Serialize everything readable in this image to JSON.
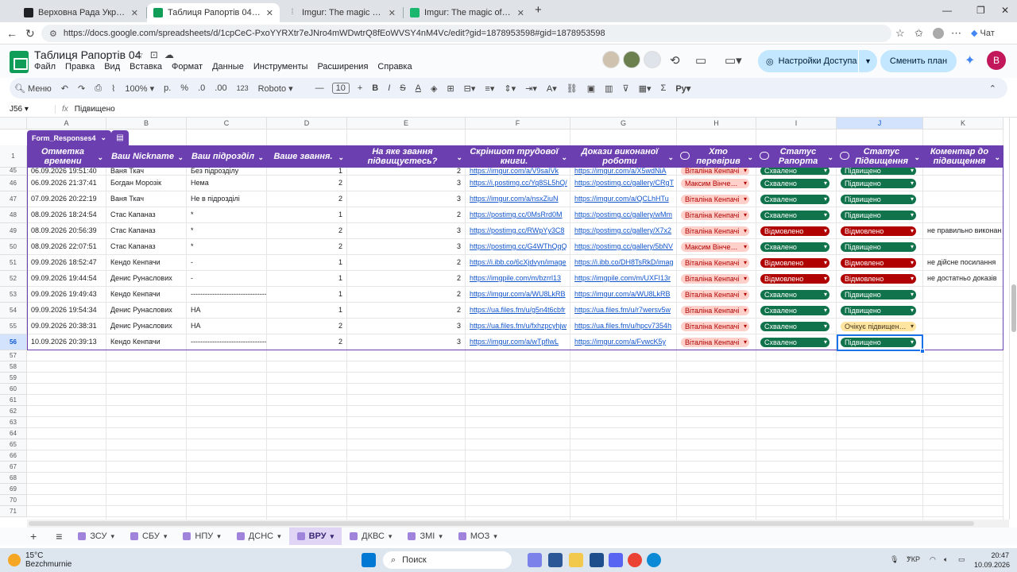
{
  "browser": {
    "tabs": [
      {
        "title": "Верховна Рада України | Рапорт",
        "color": "#202124"
      },
      {
        "title": "Таблиця Рапортів 04 - Google Та",
        "color": "#0f9d58"
      },
      {
        "title": "Imgur: The magic of the Internet",
        "color": "#777777"
      },
      {
        "title": "Imgur: The magic of the Internet",
        "color": "#1bb76e"
      }
    ],
    "url": "https://docs.google.com/spreadsheets/d/1cpCeC-PxoYYRXtr7eJNro4mWDwtrQ8fEoWVSY4nM4Vc/edit?gid=1878953598#gid=1878953598",
    "chat_label": "Чат"
  },
  "app": {
    "title": "Таблиця Рапортів 04",
    "menu": [
      "Файл",
      "Правка",
      "Вид",
      "Вставка",
      "Формат",
      "Данные",
      "Инструменты",
      "Расширения",
      "Справка"
    ],
    "share_label": "Настройки Доступа",
    "plan_label": "Сменить план",
    "user_initial": "B"
  },
  "toolbar": {
    "menu_label": "Меню",
    "zoom": "100%",
    "currency": "р.",
    "percent": "%",
    "dec_less": ".0",
    "dec_more": ".00",
    "num_format": "123",
    "font": "Roboto",
    "font_size": "10"
  },
  "formula_bar": {
    "cell": "J56",
    "value": "Підвищено"
  },
  "columns": [
    "A",
    "B",
    "C",
    "D",
    "E",
    "F",
    "G",
    "H",
    "I",
    "J",
    "K"
  ],
  "table": {
    "name": "Form_Responses4",
    "headers": [
      "Отметка времени",
      "Ваш Nickname",
      "Ваш підрозділ",
      "Ваше звання.",
      "На яке звання підвищуєтесь?",
      "Скріншот трудової книги.",
      "Докази виконаної роботи",
      "Хто перевірив",
      "Статус Рапорта",
      "Статус Підвищення",
      "Коментар до підвищення"
    ],
    "rows": [
      {
        "n": "45",
        "a": "06.09.2026 19:51:40",
        "b": "Ваня Ткач",
        "c": "Без підрозділу",
        "d": "1",
        "e": "2",
        "f": "https://imgur.com/a/V9saIVk",
        "g": "https://imgur.com/a/X5wdNiA",
        "h": "Віталіна Кенпачі",
        "i": "Схвалено",
        "j": "Підвищено",
        "k": ""
      },
      {
        "n": "46",
        "a": "06.09.2026 21:37:41",
        "b": "Богдан Морозік",
        "c": "Нема",
        "d": "2",
        "e": "3",
        "f": "https://i.postimg.cc/Yq8SL5hQ/",
        "g": "https://postimg.cc/gallery/CRgT",
        "h": "Максим Вінчестер",
        "i": "Схвалено",
        "j": "Підвищено",
        "k": ""
      },
      {
        "n": "47",
        "a": "07.09.2026 20:22:19",
        "b": "Ваня Ткач",
        "c": "Не в підрозділі",
        "d": "2",
        "e": "3",
        "f": "https://imgur.com/a/nsxZiuN",
        "g": "https://imgur.com/a/QCLhHTu",
        "h": "Віталіна Кенпачі",
        "i": "Схвалено",
        "j": "Підвищено",
        "k": ""
      },
      {
        "n": "48",
        "a": "08.09.2026 18:24:54",
        "b": "Стас Капаназ",
        "c": "*",
        "d": "1",
        "e": "2",
        "f": "https://postimg.cc/0MsRrd0M",
        "g": "https://postimg.cc/gallery/wMm",
        "h": "Віталіна Кенпачі",
        "i": "Схвалено",
        "j": "Підвищено",
        "k": ""
      },
      {
        "n": "49",
        "a": "08.09.2026 20:56:39",
        "b": "Стас Капаназ",
        "c": "*",
        "d": "2",
        "e": "3",
        "f": "https://postimg.cc/RWpYy3C8",
        "g": "https://postimg.cc/gallery/X7x2",
        "h": "Віталіна Кенпачі",
        "i": "Відмовлено",
        "j": "Відмовлено",
        "k": "не правильно виконан"
      },
      {
        "n": "50",
        "a": "08.09.2026 22:07:51",
        "b": "Стас Капаназ",
        "c": "*",
        "d": "2",
        "e": "3",
        "f": "https://postimg.cc/G4WThQqQ",
        "g": "https://postimg.cc/gallery/5bNV",
        "h": "Максим Вінчестер",
        "i": "Схвалено",
        "j": "Підвищено",
        "k": ""
      },
      {
        "n": "51",
        "a": "09.09.2026 18:52:47",
        "b": "Кендо Кенпачи",
        "c": "-",
        "d": "1",
        "e": "2",
        "f": "https://i.ibb.co/6cXjdvyn/image",
        "g": "https://i.ibb.co/DH8TsRkD/imag",
        "h": "Віталіна Кенпачі",
        "i": "Відмовлено",
        "j": "Відмовлено",
        "k": "не дійсне посилання"
      },
      {
        "n": "52",
        "a": "09.09.2026 19:44:54",
        "b": "Денис Рунасловиx",
        "c": "-",
        "d": "1",
        "e": "2",
        "f": "https://imgpile.com/m/bzrrl13",
        "g": "https://imgpile.com/m/UXFI13r",
        "h": "Віталіна Кенпачі",
        "i": "Відмовлено",
        "j": "Відмовлено",
        "k": "не достатньо доказів"
      },
      {
        "n": "53",
        "a": "09.09.2026 19:49:43",
        "b": "Кендо Кенпачи",
        "c": "-------------------------------------",
        "d": "1",
        "e": "2",
        "f": "https://imgur.com/a/WU8LkRB",
        "g": "https://imgur.com/a/WU8LkRB",
        "h": "Віталіна Кенпачі",
        "i": "Схвалено",
        "j": "Підвищено",
        "k": ""
      },
      {
        "n": "54",
        "a": "09.09.2026 19:54:34",
        "b": "Денис Рунасловиx",
        "c": "НА",
        "d": "1",
        "e": "2",
        "f": "https://ua.files.fm/u/g5n4t6cbfr",
        "g": "https://ua.files.fm/u/r7wersv5w",
        "h": "Віталіна Кенпачі",
        "i": "Схвалено",
        "j": "Підвищено",
        "k": ""
      },
      {
        "n": "55",
        "a": "09.09.2026 20:38:31",
        "b": "Денис Рунасловиx",
        "c": "НА",
        "d": "2",
        "e": "3",
        "f": "https://ua.files.fm/u/fxhzpcyhjw",
        "g": "https://ua.files.fm/u/hpcv7354h",
        "h": "Віталіна Кенпачі",
        "i": "Схвалено",
        "j": "Очікує підвищення",
        "k": ""
      },
      {
        "n": "56",
        "a": "10.09.2026 20:39:13",
        "b": "Кендо Кенпачи",
        "c": "-------------------------------------",
        "d": "2",
        "e": "3",
        "f": "https://imgur.com/a/wTpfIwL",
        "g": "https://imgur.com/a/FvwcK5y",
        "h": "Віталіна Кенпачі",
        "i": "Схвалено",
        "j": "Підвищено",
        "k": ""
      }
    ],
    "empty_rows": [
      "57",
      "58",
      "59",
      "60",
      "61",
      "62",
      "63",
      "64",
      "65",
      "66",
      "67",
      "68",
      "69",
      "70",
      "71"
    ]
  },
  "status_colors": {
    "Схвалено": "green",
    "Відмовлено": "red",
    "Підвищено": "green",
    "Очікує підвищення": "yellow"
  },
  "sheets": [
    {
      "label": "ЗСУ",
      "active": false
    },
    {
      "label": "СБУ",
      "active": false
    },
    {
      "label": "НПУ",
      "active": false
    },
    {
      "label": "ДСНС",
      "active": false
    },
    {
      "label": "ВРУ",
      "active": true
    },
    {
      "label": "ДКВС",
      "active": false
    },
    {
      "label": "ЗМІ",
      "active": false
    },
    {
      "label": "МОЗ",
      "active": false
    }
  ],
  "taskbar": {
    "weather_temp": "15°C",
    "weather_desc": "Bezchmurnie",
    "search_label": "Поиск",
    "lang": "УКР",
    "time": "20:47",
    "date": "10.09.2026"
  }
}
